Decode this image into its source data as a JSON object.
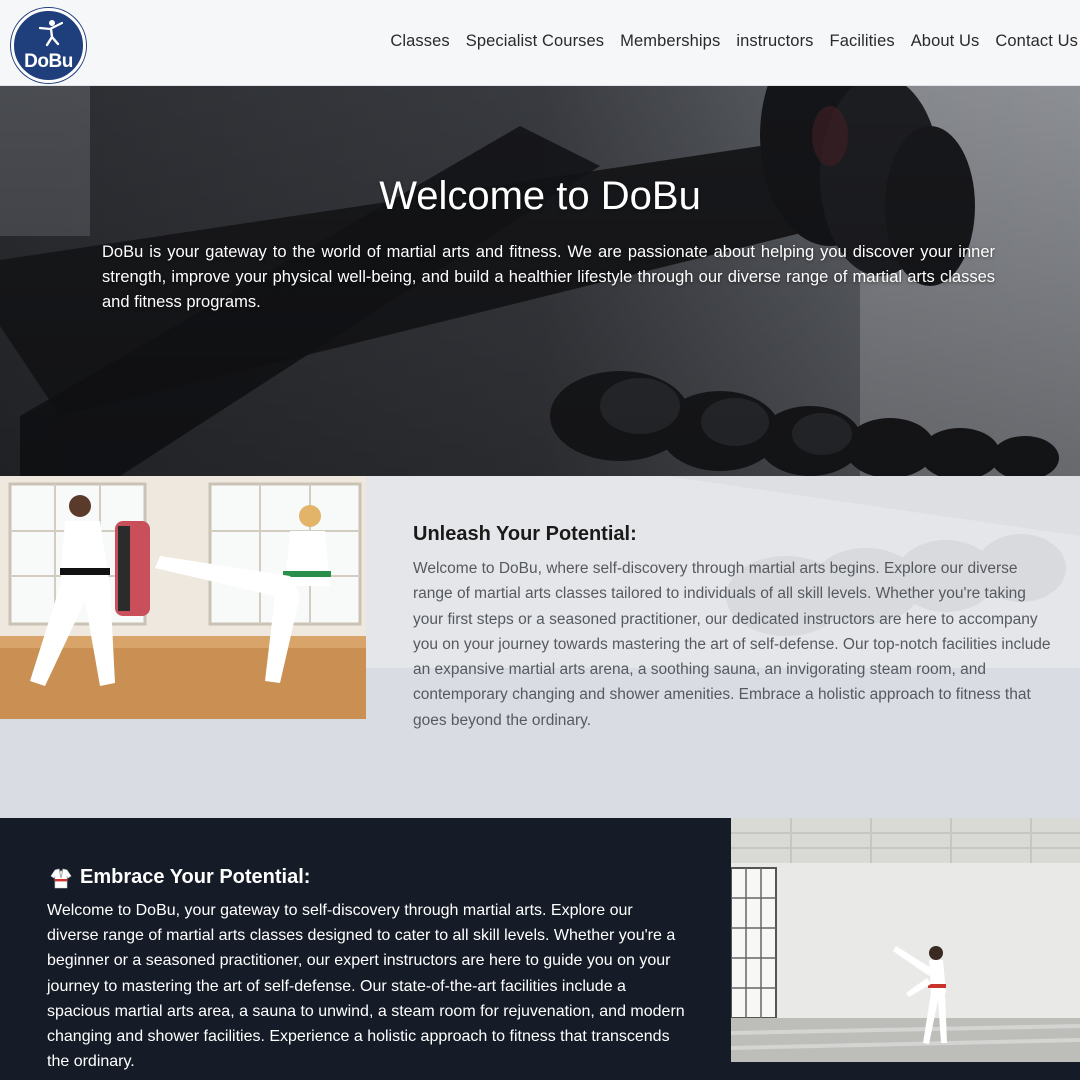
{
  "header": {
    "logo_text": "DoBu",
    "nav": [
      "Classes",
      "Specialist Courses",
      "Memberships",
      "instructors",
      "Facilities",
      "About Us",
      "Contact Us"
    ]
  },
  "hero": {
    "title": "Welcome to DoBu",
    "text": "DoBu is your gateway to the world of martial arts and fitness. We are passionate about helping you discover your inner strength, improve your physical well-being, and build a healthier lifestyle through our diverse range of martial arts classes and fitness programs."
  },
  "section2": {
    "title": "Unleash Your Potential:",
    "text": "Welcome to DoBu, where self-discovery through martial arts begins. Explore our diverse range of martial arts classes tailored to individuals of all skill levels. Whether you're taking your first steps or a seasoned practitioner, our dedicated instructors are here to accompany you on your journey towards mastering the art of self-defense. Our top-notch facilities include an expansive martial arts arena, a soothing sauna, an invigorating steam room, and contemporary changing and shower amenities. Embrace a holistic approach to fitness that goes beyond the ordinary."
  },
  "section3": {
    "title": "Embrace Your Potential:",
    "text": "Welcome to DoBu, your gateway to self-discovery through martial arts. Explore our diverse range of martial arts classes designed to cater to all skill levels. Whether you're a beginner or a seasoned practitioner, our expert instructors are here to guide you on your journey to mastering the art of self-defense. Our state-of-the-art facilities include a spacious martial arts area, a sauna to unwind, a steam room for rejuvenation, and modern changing and shower facilities. Experience a holistic approach to fitness that transcends the ordinary."
  },
  "colors": {
    "brand": "#1f3e7c",
    "dark_section": "#151c27",
    "light_section": "#d9dde3"
  }
}
